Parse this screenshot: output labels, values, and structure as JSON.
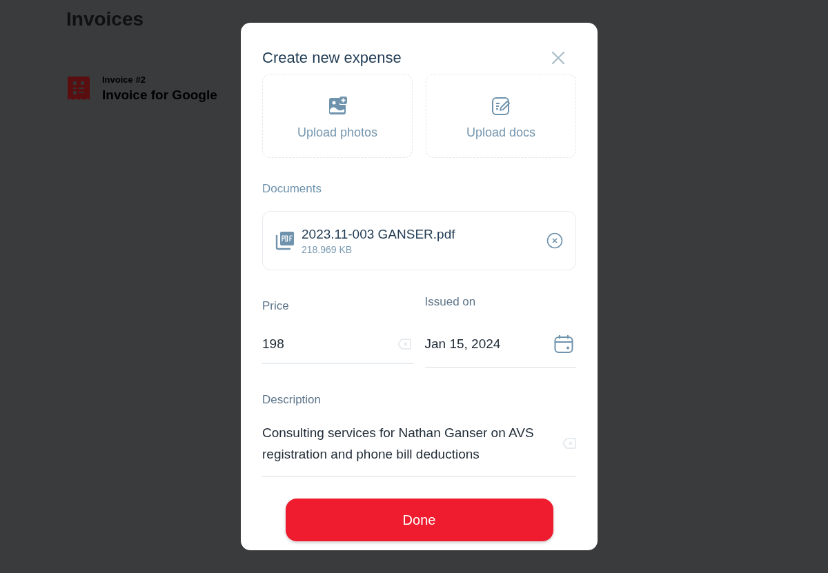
{
  "page": {
    "title": "Invoices",
    "invoices": [
      {
        "number": "Invoice #2",
        "name": "Invoice for Google"
      }
    ]
  },
  "dialog": {
    "title": "Create new expense",
    "uploads": [
      {
        "kind": "photos",
        "label": "Upload photos"
      },
      {
        "kind": "docs",
        "label": "Upload docs"
      }
    ],
    "documents_label": "Documents",
    "documents": [
      {
        "name": "2023.11-003 GANSER.pdf",
        "size": "218.969 KB"
      }
    ],
    "price": {
      "label": "Price",
      "value": "198"
    },
    "issued_on": {
      "label": "Issued on",
      "value": "Jan 15, 2024"
    },
    "description": {
      "label": "Description",
      "value": "Consulting services for Nathan Ganser on AVS registration and phone bill deductions"
    },
    "done_button": "Done"
  }
}
